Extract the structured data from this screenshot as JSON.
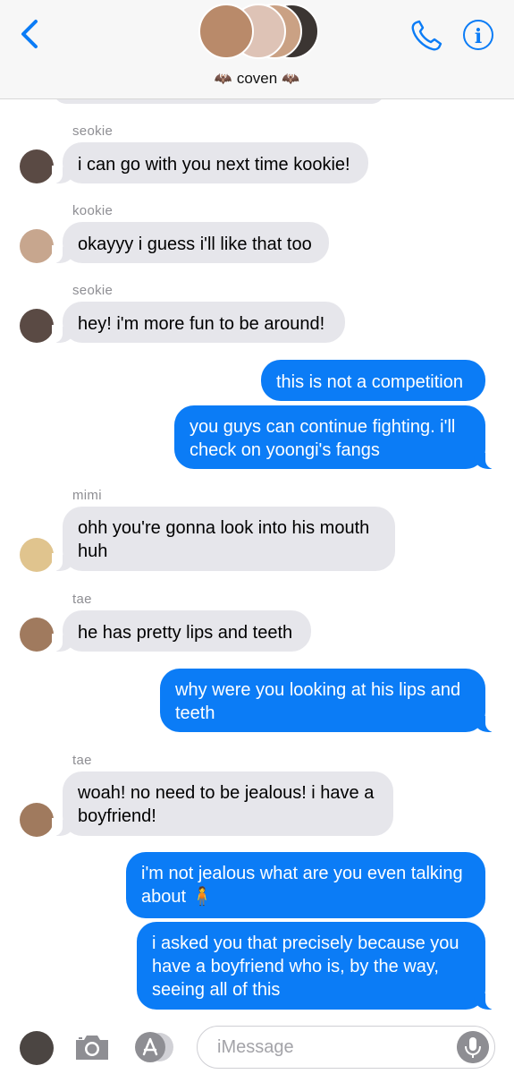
{
  "header": {
    "group_name": "coven",
    "bat_emoji": "🦇"
  },
  "messages": [
    {
      "sender": "seokie",
      "text_lines": [
        "i can go with you next time kookie!"
      ]
    },
    {
      "sender": "kookie",
      "text_lines": [
        "okayyy i guess i'll like that too"
      ]
    },
    {
      "sender": "seokie",
      "text_lines": [
        "hey! i'm more fun to be around!"
      ]
    },
    {
      "sender": "",
      "text_lines": [
        "this is not a competition"
      ]
    },
    {
      "sender": "",
      "text_lines": [
        "you guys can continue fighting. i'll",
        "check on yoongi's fangs"
      ]
    },
    {
      "sender": "mimi",
      "text_lines": [
        "ohh you're gonna look into his mouth",
        "huh"
      ]
    },
    {
      "sender": "tae",
      "text_lines": [
        "he has pretty lips and teeth"
      ]
    },
    {
      "sender": "",
      "text_lines": [
        "why were you looking at his lips and",
        "teeth"
      ]
    },
    {
      "sender": "tae",
      "text_lines": [
        "woah! no need to be jealous! i have a",
        "boyfriend!"
      ]
    },
    {
      "sender": "",
      "text_lines": [
        "i'm not jealous what are you even talking",
        "about 🧍"
      ]
    },
    {
      "sender": "",
      "text_lines": [
        "i asked you that precisely because you",
        "have a boyfriend who is, by the way,",
        "seeing all of this"
      ]
    }
  ],
  "composer": {
    "placeholder": "iMessage"
  },
  "colors": {
    "accent": "#0b7cf6",
    "incoming_bubble": "#e6e6eb",
    "sender_label": "#8e8e93"
  }
}
